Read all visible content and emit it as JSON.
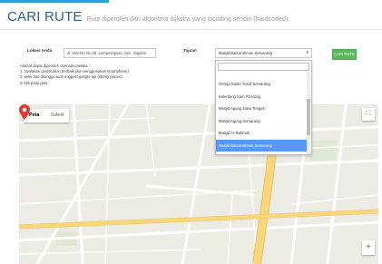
{
  "header": {
    "title": "CARI RUTE",
    "subtitle": "Rute diperoleh dari algoritma dijkstra yang dicoding sendiri (hardcoded)."
  },
  "form": {
    "location_label": "Lokasi Anda",
    "location_value": "Jl. Veteran No.29, Lamposngsari, Kec. Gajahm",
    "destination_label": "Tujuan",
    "destination_value": "Masjid Baiturrahman Semarang",
    "route_button": "CARI RUTE"
  },
  "info_lines": [
    "Alamat dapat diperoleh otomatis melalui :",
    "1. Nyalakan geolocation (terbaik jika menggunakan smartphone)",
    "2. ketik dan ditunggu auto suggest google api (library places)",
    "3. klik pada peta"
  ],
  "dropdown": {
    "items": [
      "Gereja Santo Yusuf Semarang",
      "Kelenteng Sam Po Kong",
      "Masjid Agung Jawa Tengah",
      "Masjid Agung Semarang",
      "Masjid Ar-Rahmah",
      "Masjid Baiturrahman Semarang"
    ],
    "selected_index": 5
  },
  "map": {
    "tab_map": "Peta",
    "tab_satellite": "Satelit",
    "active_tab": "Peta"
  },
  "colors": {
    "title": "#2f5f8f",
    "button": "#5cb85c",
    "selected_item": "#5897fb",
    "marker": "#e53935",
    "major_road": "#f9d67a"
  },
  "icons": {
    "fullscreen": "fullscreen-icon",
    "pegman": "pegman-icon",
    "zoom_in": "plus-icon",
    "marker": "map-marker-icon"
  }
}
